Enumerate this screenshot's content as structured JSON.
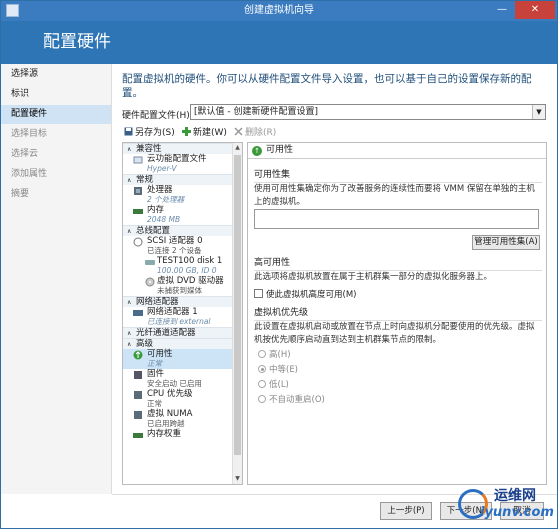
{
  "window": {
    "title": "创建虚拟机向导",
    "minimize": "—",
    "close": "✕"
  },
  "banner": {
    "title": "配置硬件"
  },
  "nav": {
    "items": [
      {
        "label": "选择源",
        "state": "normal"
      },
      {
        "label": "标识",
        "state": "normal"
      },
      {
        "label": "配置硬件",
        "state": "active"
      },
      {
        "label": "选择目标",
        "state": "disabled"
      },
      {
        "label": "选择云",
        "state": "disabled"
      },
      {
        "label": "添加属性",
        "state": "disabled"
      },
      {
        "label": "摘要",
        "state": "disabled"
      }
    ]
  },
  "intro": "配置虚拟机的硬件。你可以从硬件配置文件导入设置，也可以基于自己的设置保存新的配置。",
  "profile": {
    "label": "硬件配置文件(H):",
    "value": "[默认值 - 创建新硬件配置设置]",
    "arrow": "▼"
  },
  "toolbar": {
    "save": "另存为(S)",
    "new": "新建(W)",
    "delete": "删除(R)"
  },
  "tree": {
    "cat_compat": "兼容性",
    "cloud_cap": "云功能配置文件",
    "cloud_cap_sub": "Hyper-V",
    "cat_general": "常规",
    "cpu": "处理器",
    "cpu_sub": "2 个处理器",
    "mem": "内存",
    "mem_sub": "2048 MB",
    "cat_bus": "总线配置",
    "scsi": "SCSI 适配器 0",
    "scsi_sub": "已连接 2 个设备",
    "disk": "TEST100 disk 1",
    "disk_sub": "100.00 GB, ID 0",
    "dvd": "虚拟 DVD 驱动器",
    "dvd_sub": "未捕获到媒体",
    "cat_net": "网络适配器",
    "nic": "网络适配器 1",
    "nic_sub": "已连接到 external",
    "cat_fc": "光纤通道适配器",
    "cat_adv": "高级",
    "avail": "可用性",
    "avail_sub": "正常",
    "fw": "固件",
    "fw_sub": "安全启动 已启用",
    "cpuprio": "CPU 优先级",
    "cpuprio_sub": "正常",
    "numa": "虚拟 NUMA",
    "numa_sub": "已启用跨越",
    "memw": "内存权重",
    "collapse": "∧"
  },
  "panel": {
    "header": "可用性",
    "set_title": "可用性集",
    "set_desc": "使用可用性集确定你为了改善服务的连续性而要将 VMM 保留在单独的主机上的虚拟机。",
    "manage_btn": "管理可用性集(A)",
    "ha_title": "高可用性",
    "ha_desc": "此选项将虚拟机放置在属于主机群集一部分的虚拟化服务器上。",
    "ha_check": "使此虚拟机高度可用(M)",
    "prio_title": "虚拟机优先级",
    "prio_desc": "此设置在虚拟机启动或放置在节点上时向虚拟机分配要使用的优先级。虚拟机按优先顺序启动直到达到主机群集节点的限制。",
    "prio_options": [
      "高(H)",
      "中等(E)",
      "低(L)",
      "不自动重启(O)"
    ]
  },
  "footer": {
    "prev": "上一步(P)",
    "next": "下一步(N)",
    "cancel": "取消"
  },
  "watermark": {
    "t1": "运维网",
    "t2": "iyunv.com"
  }
}
